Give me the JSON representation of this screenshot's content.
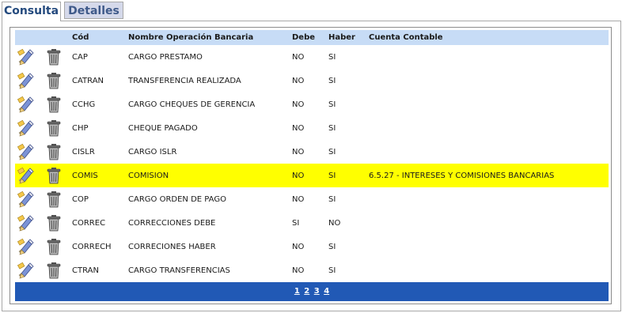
{
  "tabs": [
    {
      "label": "Consulta"
    },
    {
      "label": "Detalles"
    }
  ],
  "table": {
    "headers": [
      "",
      "",
      "Cód",
      "Nombre Operación Bancaria",
      "Debe",
      "Haber",
      "Cuenta Contable"
    ],
    "rows": [
      {
        "cod": "CAP",
        "nombre": "CARGO PRESTAMO",
        "debe": "NO",
        "haber": "SI",
        "cuenta": ""
      },
      {
        "cod": "CATRAN",
        "nombre": "TRANSFERENCIA REALIZADA",
        "debe": "NO",
        "haber": "SI",
        "cuenta": ""
      },
      {
        "cod": "CCHG",
        "nombre": "CARGO CHEQUES DE GERENCIA",
        "debe": "NO",
        "haber": "SI",
        "cuenta": ""
      },
      {
        "cod": "CHP",
        "nombre": "CHEQUE PAGADO",
        "debe": "NO",
        "haber": "SI",
        "cuenta": ""
      },
      {
        "cod": "CISLR",
        "nombre": "CARGO ISLR",
        "debe": "NO",
        "haber": "SI",
        "cuenta": ""
      },
      {
        "cod": "COMIS",
        "nombre": "COMISION",
        "debe": "NO",
        "haber": "SI",
        "cuenta": "6.5.27 - INTERESES Y COMISIONES BANCARIAS"
      },
      {
        "cod": "COP",
        "nombre": "CARGO ORDEN DE PAGO",
        "debe": "NO",
        "haber": "SI",
        "cuenta": ""
      },
      {
        "cod": "CORREC",
        "nombre": "CORRECCIONES DEBE",
        "debe": "SI",
        "haber": "NO",
        "cuenta": ""
      },
      {
        "cod": "CORRECH",
        "nombre": "CORRECIONES HABER",
        "debe": "NO",
        "haber": "SI",
        "cuenta": ""
      },
      {
        "cod": "CTRAN",
        "nombre": "CARGO TRANSFERENCIAS",
        "debe": "NO",
        "haber": "SI",
        "cuenta": ""
      }
    ],
    "highlighted_row_index": 5,
    "highlight_color": "#ffff00",
    "header_color": "#c7dcf6"
  },
  "pager": {
    "pages": [
      "1",
      "2",
      "3",
      "4"
    ],
    "background": "#2159b5"
  },
  "icons": {
    "edit": "edit-pencil-icon",
    "delete": "trash-can-icon"
  }
}
